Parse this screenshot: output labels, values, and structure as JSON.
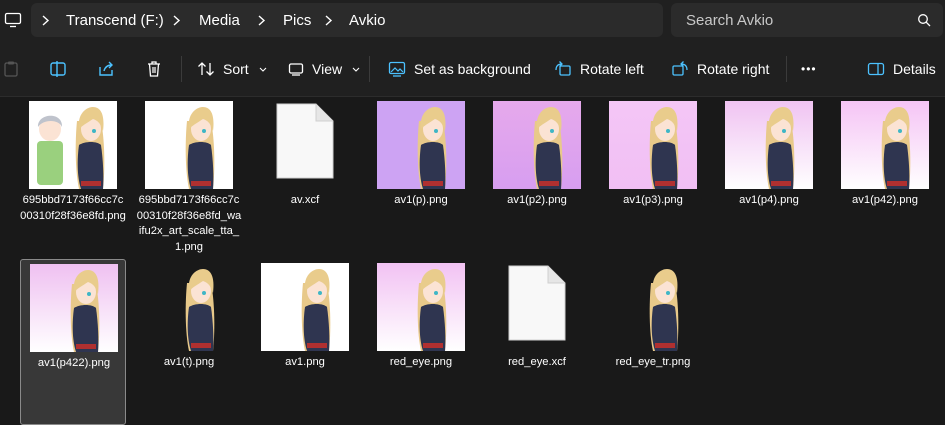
{
  "breadcrumb": [
    "Transcend (F:)",
    "Media",
    "Pics",
    "Avkio"
  ],
  "search": {
    "placeholder": "Search Avkio"
  },
  "toolbar": {
    "sort": "Sort",
    "view": "View",
    "set_background": "Set as background",
    "rotate_left": "Rotate left",
    "rotate_right": "Rotate right",
    "more": "•••",
    "details": "Details"
  },
  "files": [
    {
      "name": "695bbd7173f66cc7c00310f28f36e8fd.png",
      "kind": "image",
      "bg": "#ffffff",
      "bg2": "#ffffff",
      "duo": true
    },
    {
      "name": "695bbd7173f66cc7c00310f28f36e8fd_waifu2x_art_scale_tta_1.png",
      "kind": "image",
      "bg": "#ffffff",
      "bg2": "#ffffff"
    },
    {
      "name": "av.xcf",
      "kind": "document"
    },
    {
      "name": "av1(p).png",
      "kind": "image",
      "bg": "#cda3f3",
      "bg2": "#cda3f3"
    },
    {
      "name": "av1(p2).png",
      "kind": "image",
      "bg": "#d79ef0",
      "bg2": "#e6a9ec"
    },
    {
      "name": "av1(p3).png",
      "kind": "image",
      "bg": "#f1bff4",
      "bg2": "#f4c6f6"
    },
    {
      "name": "av1(p4).png",
      "kind": "image",
      "bg": "#ffffff",
      "bg2": "#f0c3f2"
    },
    {
      "name": "av1(p42).png",
      "kind": "image",
      "bg": "#ffffff",
      "bg2": "#f5c4f5"
    },
    {
      "name": "av1(p422).png",
      "kind": "image",
      "bg": "#ffffff",
      "bg2": "#efc0f1",
      "selected": true
    },
    {
      "name": "av1(t).png",
      "kind": "image",
      "bg": "#191919",
      "bg2": "#191919"
    },
    {
      "name": "av1.png",
      "kind": "image",
      "bg": "#ffffff",
      "bg2": "#ffffff"
    },
    {
      "name": "red_eye.png",
      "kind": "image",
      "bg": "#ffffff",
      "bg2": "#f2c2f3"
    },
    {
      "name": "red_eye.xcf",
      "kind": "document"
    },
    {
      "name": "red_eye_tr.png",
      "kind": "image",
      "bg": "#191919",
      "bg2": "#191919"
    }
  ],
  "colors": {
    "window": "#191919",
    "bar": "#202020",
    "field": "#2b2b2b",
    "accent": "#4cc2ff"
  }
}
